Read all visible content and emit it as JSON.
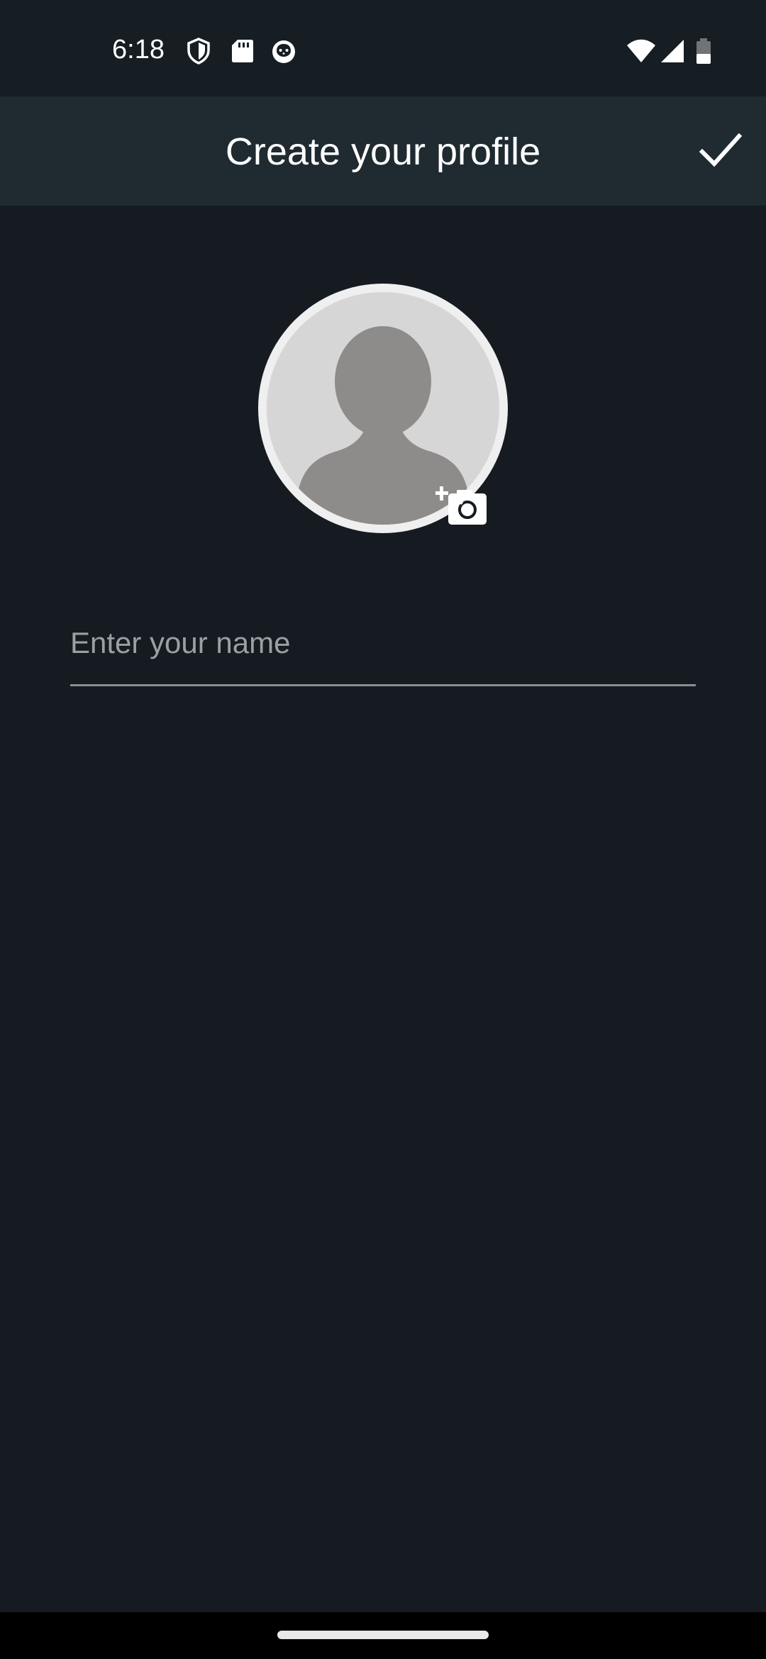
{
  "status_bar": {
    "time": "6:18",
    "left_icons": [
      "shield-icon",
      "sd-card-icon",
      "cat-face-icon"
    ],
    "right_icons": [
      "wifi-icon",
      "signal-icon",
      "battery-icon"
    ]
  },
  "app_bar": {
    "title": "Create your profile",
    "confirm_icon": "check-icon"
  },
  "profile": {
    "avatar_icon": "default-avatar-icon",
    "add_photo_icon": "add-photo-camera-icon"
  },
  "name_field": {
    "value": "",
    "placeholder": "Enter your name"
  },
  "colors": {
    "background": "#151b21",
    "app_bar": "#1f2a31",
    "text": "#ffffff",
    "placeholder": "#9aa0a4"
  }
}
